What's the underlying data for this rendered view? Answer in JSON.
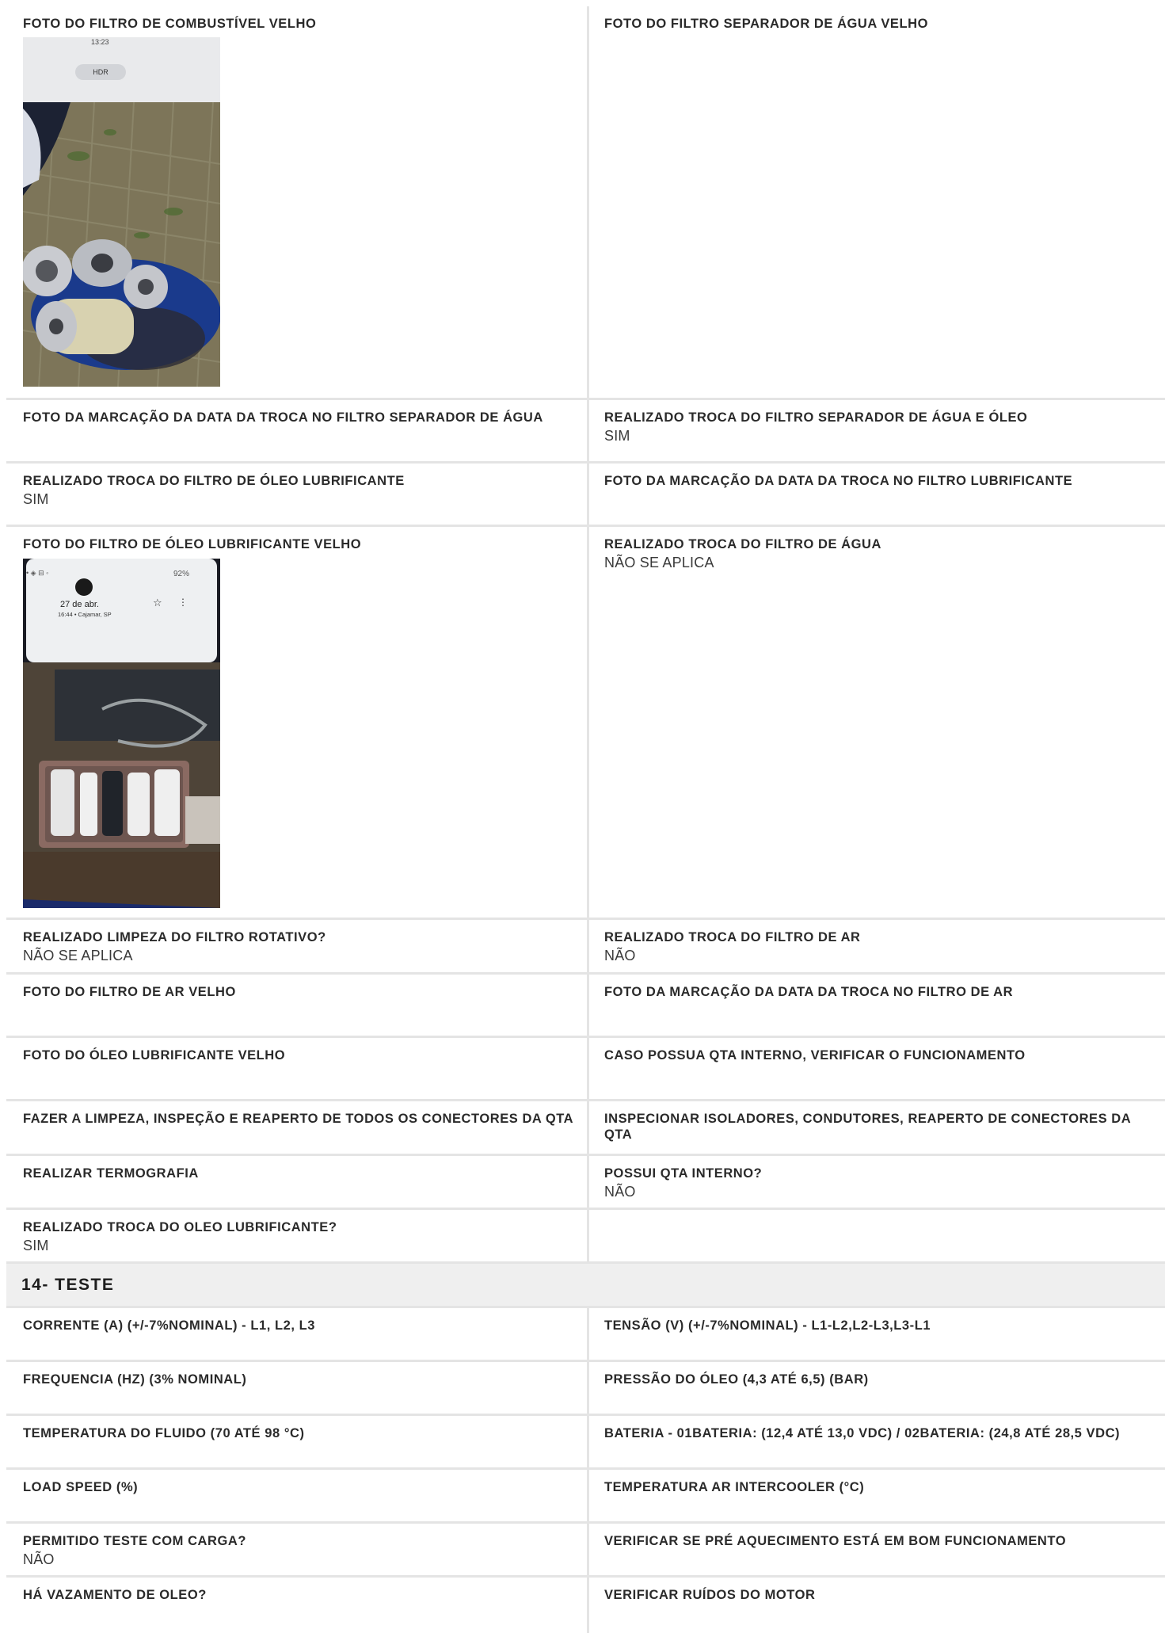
{
  "rows_a": [
    {
      "left": {
        "label": "FOTO DO FILTRO DE COMBUSTÍVEL VELHO",
        "value": "",
        "photo": "photo1"
      },
      "right": {
        "label": "FOTO DO FILTRO SEPARADOR DE ÁGUA VELHO",
        "value": ""
      }
    },
    {
      "left": {
        "label": "FOTO DA MARCAÇÃO DA DATA DA TROCA NO FILTRO SEPARADOR DE ÁGUA",
        "value": ""
      },
      "right": {
        "label": "REALIZADO TROCA DO FILTRO SEPARADOR DE ÁGUA E ÓLEO",
        "value": "SIM"
      }
    },
    {
      "left": {
        "label": "REALIZADO TROCA DO FILTRO DE ÓLEO LUBRIFICANTE",
        "value": "SIM"
      },
      "right": {
        "label": "FOTO DA MARCAÇÃO DA DATA DA TROCA NO FILTRO LUBRIFICANTE",
        "value": ""
      }
    },
    {
      "left": {
        "label": "FOTO DO FILTRO DE ÓLEO LUBRIFICANTE VELHO",
        "value": "",
        "photo": "photo2"
      },
      "right": {
        "label": "REALIZADO TROCA DO FILTRO DE ÁGUA",
        "value": "NÃO SE APLICA"
      }
    },
    {
      "left": {
        "label": "REALIZADO LIMPEZA DO FILTRO ROTATIVO?",
        "value": "NÃO SE APLICA"
      },
      "right": {
        "label": "REALIZADO TROCA DO FILTRO DE AR",
        "value": "NÃO"
      }
    },
    {
      "left": {
        "label": "FOTO DO FILTRO DE AR VELHO",
        "value": ""
      },
      "right": {
        "label": "FOTO DA MARCAÇÃO DA DATA DA TROCA NO FILTRO DE AR",
        "value": ""
      }
    },
    {
      "left": {
        "label": "FOTO DO ÓLEO LUBRIFICANTE VELHO",
        "value": ""
      },
      "right": {
        "label": "CASO POSSUA QTA INTERNO, VERIFICAR O FUNCIONAMENTO",
        "value": ""
      }
    },
    {
      "left": {
        "label": "FAZER A LIMPEZA, INSPEÇÃO E REAPERTO DE TODOS OS CONECTORES DA QTA",
        "value": ""
      },
      "right": {
        "label": "INSPECIONAR ISOLADORES, CONDUTORES, REAPERTO DE CONECTORES DA QTA",
        "value": ""
      }
    },
    {
      "left": {
        "label": "REALIZAR TERMOGRAFIA",
        "value": ""
      },
      "right": {
        "label": "POSSUI QTA INTERNO?",
        "value": "NÃO"
      }
    },
    {
      "left": {
        "label": "REALIZADO TROCA DO OLEO LUBRIFICANTE?",
        "value": "SIM"
      },
      "right": {
        "label": "",
        "value": ""
      }
    }
  ],
  "photo1": {
    "time": "13:23",
    "hdr": "HDR"
  },
  "photo2": {
    "date": "27 de abr.",
    "place": "16:44 • Cajamar, SP",
    "battery": "92%"
  },
  "section_title": "14- TESTE",
  "rows_b": [
    {
      "left": {
        "label": "CORRENTE (A) (+/-7%NOMINAL) - L1, L2, L3",
        "value": ""
      },
      "right": {
        "label": "TENSÃO (V) (+/-7%NOMINAL) - L1-L2,L2-L3,L3-L1",
        "value": ""
      }
    },
    {
      "left": {
        "label": "FREQUENCIA (HZ) (3% NOMINAL)",
        "value": ""
      },
      "right": {
        "label": "PRESSÃO DO ÓLEO (4,3 ATÉ 6,5) (BAR)",
        "value": ""
      }
    },
    {
      "left": {
        "label": "TEMPERATURA DO FLUIDO (70 ATÉ 98 °C)",
        "value": ""
      },
      "right": {
        "label": "BATERIA - 01BATERIA: (12,4 ATÉ 13,0 VDC) / 02BATERIA: (24,8 ATÉ 28,5 VDC)",
        "value": ""
      }
    },
    {
      "left": {
        "label": "LOAD SPEED (%)",
        "value": ""
      },
      "right": {
        "label": "TEMPERATURA AR INTERCOOLER (°C)",
        "value": ""
      }
    },
    {
      "left": {
        "label": "PERMITIDO TESTE COM CARGA?",
        "value": "NÃO"
      },
      "right": {
        "label": "VERIFICAR SE PRÉ AQUECIMENTO ESTÁ EM BOM FUNCIONAMENTO",
        "value": ""
      }
    },
    {
      "left": {
        "label": "HÁ VAZAMENTO DE OLEO?",
        "value": ""
      },
      "right": {
        "label": "VERIFICAR RUÍDOS DO MOTOR",
        "value": ""
      }
    }
  ]
}
